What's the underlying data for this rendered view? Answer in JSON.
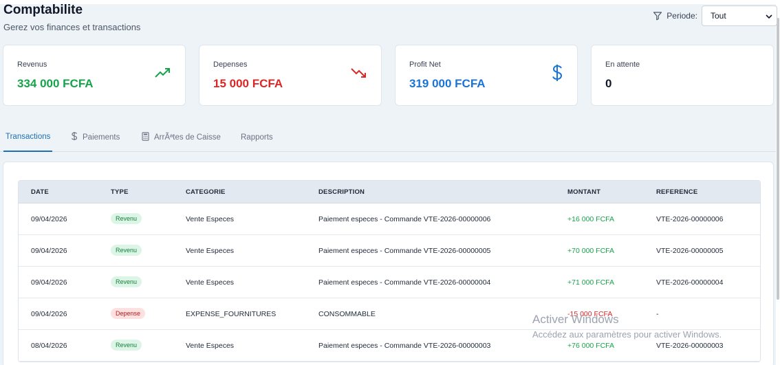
{
  "header": {
    "title": "Comptabilite",
    "subtitle": "Gerez vos finances et transactions"
  },
  "filter": {
    "label": "Periode:",
    "selected": "Tout"
  },
  "cards": [
    {
      "label": "Revenus",
      "value": "334 000 FCFA",
      "color": "#16a34a",
      "icon": "trending-up-icon"
    },
    {
      "label": "Depenses",
      "value": "15 000 FCFA",
      "color": "#dc2626",
      "icon": "trending-down-icon"
    },
    {
      "label": "Profit Net",
      "value": "319 000 FCFA",
      "color": "#1a73d9",
      "icon": "dollar-icon"
    },
    {
      "label": "En attente",
      "value": "0",
      "color": "#111827",
      "icon": ""
    }
  ],
  "tabs": [
    {
      "label": "Transactions",
      "active": true
    },
    {
      "label": "Paiements",
      "icon": "dollar-icon"
    },
    {
      "label": "ArrÃªtes de Caisse",
      "icon": "calculator-icon"
    },
    {
      "label": "Rapports"
    }
  ],
  "table": {
    "headers": {
      "date": "DATE",
      "type": "TYPE",
      "category": "CATEGORIE",
      "description": "DESCRIPTION",
      "amount": "MONTANT",
      "reference": "REFERENCE"
    },
    "rows": [
      {
        "date": "09/04/2026",
        "type": "Revenu",
        "category": "Vente Especes",
        "description": "Paiement especes - Commande VTE-2026-00000006",
        "amount": "+16 000 FCFA",
        "reference": "VTE-2026-00000006"
      },
      {
        "date": "09/04/2026",
        "type": "Revenu",
        "category": "Vente Especes",
        "description": "Paiement especes - Commande VTE-2026-00000005",
        "amount": "+70 000 FCFA",
        "reference": "VTE-2026-00000005"
      },
      {
        "date": "09/04/2026",
        "type": "Revenu",
        "category": "Vente Especes",
        "description": "Paiement especes - Commande VTE-2026-00000004",
        "amount": "+71 000 FCFA",
        "reference": "VTE-2026-00000004"
      },
      {
        "date": "09/04/2026",
        "type": "Depense",
        "category": "EXPENSE_FOURNITURES",
        "description": "CONSOMMABLE",
        "amount": "-15 000 FCFA",
        "reference": "-"
      },
      {
        "date": "08/04/2026",
        "type": "Revenu",
        "category": "Vente Especes",
        "description": "Paiement especes - Commande VTE-2026-00000003",
        "amount": "+76 000 FCFA",
        "reference": "VTE-2026-00000003"
      }
    ]
  },
  "watermark": {
    "title": "Activer Windows",
    "subtitle": "Accédez aux paramètres pour activer Windows."
  }
}
